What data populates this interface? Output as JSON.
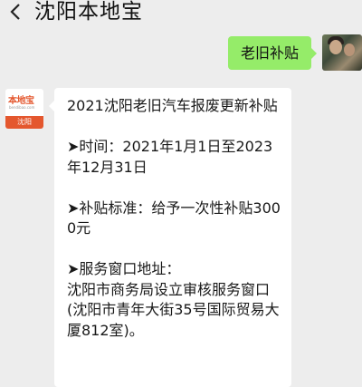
{
  "header": {
    "back_icon": "chevron-left-icon",
    "title": "沈阳本地宝"
  },
  "outgoing_message": {
    "text": "老旧补贴"
  },
  "bot": {
    "avatar_logo": "本地宝",
    "avatar_sub": "bendibao.com",
    "avatar_city": "沈阳"
  },
  "incoming_message": {
    "text": "2021沈阳老旧汽车报废更新补贴\n\n➤时间：2021年1月1日至2023年12月31日\n\n➤补贴标准：给予一次性补贴3000元\n\n➤服务窗口地址：\n沈阳市商务局设立审核服务窗口(沈阳市青年大街35号国际贸易大厦812室)。"
  }
}
